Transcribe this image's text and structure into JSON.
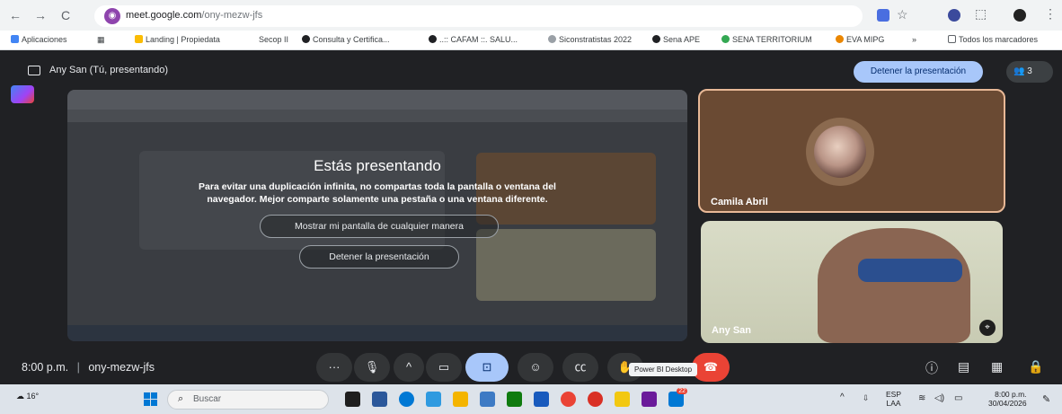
{
  "browser": {
    "url_host": "meet.google.com",
    "url_path": "/ony-mezw-jfs",
    "nav": {
      "back": "←",
      "forward": "→",
      "reload": "C"
    }
  },
  "bookmarks": {
    "apps": "Aplicaciones",
    "items": [
      "Landing | Propiedata",
      "Secop II",
      "Consulta y Certifica...",
      "..:: CAFAM ::. SALU...",
      "Siconstratistas 2022",
      "Sena APE",
      "SENA TERRITORIUM",
      "EVA MIPG"
    ],
    "overflow": "»",
    "all": "Todos los marcadores"
  },
  "meet": {
    "presenting_label": "Any San (Tú, presentando)",
    "stop_presenting_top": "Detener la presentación",
    "people_count": "3",
    "dialog": {
      "title": "Estás presentando",
      "body": "Para evitar una duplicación infinita, no compartas toda la pantalla o ventana del navegador. Mejor comparte solamente una pestaña o una ventana diferente.",
      "show_anyway": "Mostrar mi pantalla de cualquier manera",
      "stop": "Detener la presentación"
    },
    "participants": [
      {
        "name": "Camila Abril"
      },
      {
        "name": "Any San"
      }
    ],
    "meeting_time": "8:00 p.m.",
    "separator": "|",
    "meeting_code": "ony-mezw-jfs",
    "tooltip": "Power BI Desktop",
    "controls": {
      "more": "···",
      "mic": "🎙",
      "caret": "^",
      "camera": "▭",
      "present": "⊡",
      "emoji": "☺",
      "captions": "㏄",
      "raise_hand": "✋",
      "info": "ⓘ",
      "chat": "▤",
      "activities": "▦",
      "host": "🔒"
    }
  },
  "taskbar": {
    "weather": "16°",
    "search_placeholder": "Buscar",
    "language": "ESP",
    "layout": "LAA",
    "clock_time": "8:00 p.m.",
    "clock_date": "30/04/2026",
    "badge": "22"
  }
}
